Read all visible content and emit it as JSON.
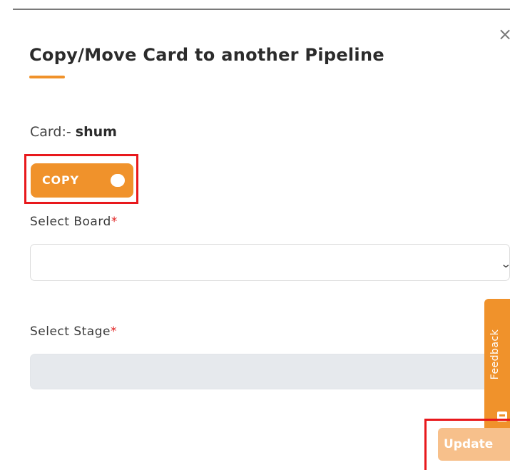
{
  "modal": {
    "close_glyph": "×",
    "title": "Copy/Move Card to another Pipeline",
    "card_prefix": "Card:-",
    "card_name": "shum",
    "toggle_label": "COPY",
    "board_label": "Select Board",
    "stage_label": "Select Stage",
    "required_marker": "*",
    "board_value": "",
    "stage_value": "",
    "update_label": "Update"
  },
  "feedback": {
    "label": "Feedback"
  },
  "colors": {
    "accent": "#f0922b",
    "update_disabled": "#f7c08b",
    "highlight": "#e8181c",
    "required": "#e02020"
  },
  "icons": [
    "close-icon",
    "chevron-down-icon",
    "feedback-icon"
  ]
}
